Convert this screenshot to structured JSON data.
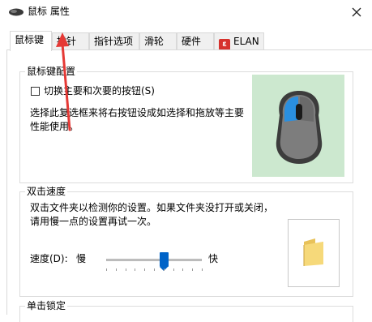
{
  "window": {
    "title": "鼠标 属性",
    "close_icon": "close-icon"
  },
  "tabs": [
    {
      "label": "鼠标键",
      "active": true
    },
    {
      "label": "指针",
      "active": false
    },
    {
      "label": "指针选项",
      "active": false
    },
    {
      "label": "滑轮",
      "active": false
    },
    {
      "label": "硬件",
      "active": false
    },
    {
      "label": "ELAN",
      "active": false,
      "icon": "elan-logo-icon"
    }
  ],
  "button_config": {
    "group_title": "鼠标键配置",
    "swap_checkbox_label": "切换主要和次要的按钮(S)",
    "swap_checked": false,
    "description": "选择此复选框来将右按钮设成如选择和拖放等主要性能使用。"
  },
  "double_click": {
    "group_title": "双击速度",
    "description": "双击文件夹以检测你的设置。如果文件夹没打开或关闭，请用慢一点的设置再试一次。",
    "speed_label": "速度(D):",
    "slow_label": "慢",
    "fast_label": "快",
    "speed_value_fraction": 0.6
  },
  "click_lock": {
    "group_title": "单击锁定"
  },
  "colors": {
    "accent": "#0063c8",
    "mouse_preview_bg": "#cce8cf",
    "annotation_arrow": "#e53935"
  }
}
